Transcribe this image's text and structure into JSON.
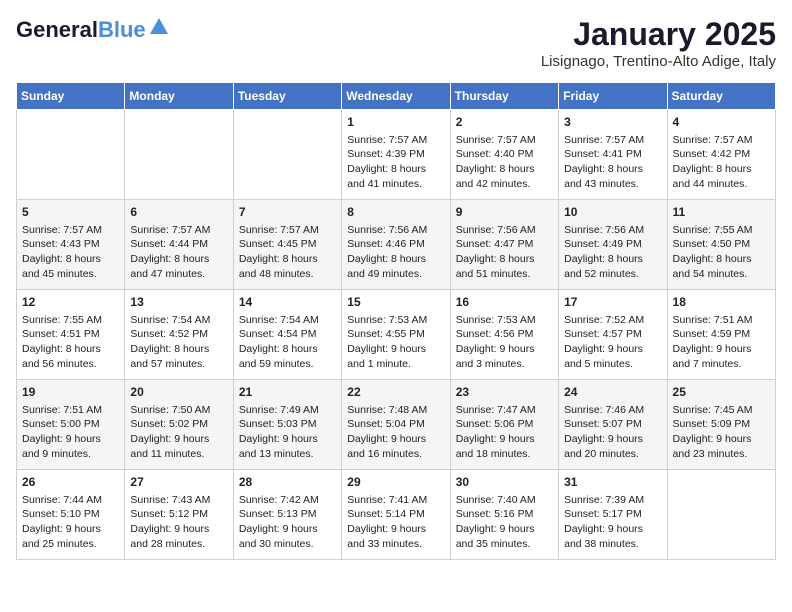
{
  "header": {
    "logo_general": "General",
    "logo_blue": "Blue",
    "month": "January 2025",
    "location": "Lisignago, Trentino-Alto Adige, Italy"
  },
  "days_of_week": [
    "Sunday",
    "Monday",
    "Tuesday",
    "Wednesday",
    "Thursday",
    "Friday",
    "Saturday"
  ],
  "weeks": [
    [
      {
        "day": "",
        "sunrise": "",
        "sunset": "",
        "daylight": ""
      },
      {
        "day": "",
        "sunrise": "",
        "sunset": "",
        "daylight": ""
      },
      {
        "day": "",
        "sunrise": "",
        "sunset": "",
        "daylight": ""
      },
      {
        "day": "1",
        "sunrise": "Sunrise: 7:57 AM",
        "sunset": "Sunset: 4:39 PM",
        "daylight": "Daylight: 8 hours and 41 minutes."
      },
      {
        "day": "2",
        "sunrise": "Sunrise: 7:57 AM",
        "sunset": "Sunset: 4:40 PM",
        "daylight": "Daylight: 8 hours and 42 minutes."
      },
      {
        "day": "3",
        "sunrise": "Sunrise: 7:57 AM",
        "sunset": "Sunset: 4:41 PM",
        "daylight": "Daylight: 8 hours and 43 minutes."
      },
      {
        "day": "4",
        "sunrise": "Sunrise: 7:57 AM",
        "sunset": "Sunset: 4:42 PM",
        "daylight": "Daylight: 8 hours and 44 minutes."
      }
    ],
    [
      {
        "day": "5",
        "sunrise": "Sunrise: 7:57 AM",
        "sunset": "Sunset: 4:43 PM",
        "daylight": "Daylight: 8 hours and 45 minutes."
      },
      {
        "day": "6",
        "sunrise": "Sunrise: 7:57 AM",
        "sunset": "Sunset: 4:44 PM",
        "daylight": "Daylight: 8 hours and 47 minutes."
      },
      {
        "day": "7",
        "sunrise": "Sunrise: 7:57 AM",
        "sunset": "Sunset: 4:45 PM",
        "daylight": "Daylight: 8 hours and 48 minutes."
      },
      {
        "day": "8",
        "sunrise": "Sunrise: 7:56 AM",
        "sunset": "Sunset: 4:46 PM",
        "daylight": "Daylight: 8 hours and 49 minutes."
      },
      {
        "day": "9",
        "sunrise": "Sunrise: 7:56 AM",
        "sunset": "Sunset: 4:47 PM",
        "daylight": "Daylight: 8 hours and 51 minutes."
      },
      {
        "day": "10",
        "sunrise": "Sunrise: 7:56 AM",
        "sunset": "Sunset: 4:49 PM",
        "daylight": "Daylight: 8 hours and 52 minutes."
      },
      {
        "day": "11",
        "sunrise": "Sunrise: 7:55 AM",
        "sunset": "Sunset: 4:50 PM",
        "daylight": "Daylight: 8 hours and 54 minutes."
      }
    ],
    [
      {
        "day": "12",
        "sunrise": "Sunrise: 7:55 AM",
        "sunset": "Sunset: 4:51 PM",
        "daylight": "Daylight: 8 hours and 56 minutes."
      },
      {
        "day": "13",
        "sunrise": "Sunrise: 7:54 AM",
        "sunset": "Sunset: 4:52 PM",
        "daylight": "Daylight: 8 hours and 57 minutes."
      },
      {
        "day": "14",
        "sunrise": "Sunrise: 7:54 AM",
        "sunset": "Sunset: 4:54 PM",
        "daylight": "Daylight: 8 hours and 59 minutes."
      },
      {
        "day": "15",
        "sunrise": "Sunrise: 7:53 AM",
        "sunset": "Sunset: 4:55 PM",
        "daylight": "Daylight: 9 hours and 1 minute."
      },
      {
        "day": "16",
        "sunrise": "Sunrise: 7:53 AM",
        "sunset": "Sunset: 4:56 PM",
        "daylight": "Daylight: 9 hours and 3 minutes."
      },
      {
        "day": "17",
        "sunrise": "Sunrise: 7:52 AM",
        "sunset": "Sunset: 4:57 PM",
        "daylight": "Daylight: 9 hours and 5 minutes."
      },
      {
        "day": "18",
        "sunrise": "Sunrise: 7:51 AM",
        "sunset": "Sunset: 4:59 PM",
        "daylight": "Daylight: 9 hours and 7 minutes."
      }
    ],
    [
      {
        "day": "19",
        "sunrise": "Sunrise: 7:51 AM",
        "sunset": "Sunset: 5:00 PM",
        "daylight": "Daylight: 9 hours and 9 minutes."
      },
      {
        "day": "20",
        "sunrise": "Sunrise: 7:50 AM",
        "sunset": "Sunset: 5:02 PM",
        "daylight": "Daylight: 9 hours and 11 minutes."
      },
      {
        "day": "21",
        "sunrise": "Sunrise: 7:49 AM",
        "sunset": "Sunset: 5:03 PM",
        "daylight": "Daylight: 9 hours and 13 minutes."
      },
      {
        "day": "22",
        "sunrise": "Sunrise: 7:48 AM",
        "sunset": "Sunset: 5:04 PM",
        "daylight": "Daylight: 9 hours and 16 minutes."
      },
      {
        "day": "23",
        "sunrise": "Sunrise: 7:47 AM",
        "sunset": "Sunset: 5:06 PM",
        "daylight": "Daylight: 9 hours and 18 minutes."
      },
      {
        "day": "24",
        "sunrise": "Sunrise: 7:46 AM",
        "sunset": "Sunset: 5:07 PM",
        "daylight": "Daylight: 9 hours and 20 minutes."
      },
      {
        "day": "25",
        "sunrise": "Sunrise: 7:45 AM",
        "sunset": "Sunset: 5:09 PM",
        "daylight": "Daylight: 9 hours and 23 minutes."
      }
    ],
    [
      {
        "day": "26",
        "sunrise": "Sunrise: 7:44 AM",
        "sunset": "Sunset: 5:10 PM",
        "daylight": "Daylight: 9 hours and 25 minutes."
      },
      {
        "day": "27",
        "sunrise": "Sunrise: 7:43 AM",
        "sunset": "Sunset: 5:12 PM",
        "daylight": "Daylight: 9 hours and 28 minutes."
      },
      {
        "day": "28",
        "sunrise": "Sunrise: 7:42 AM",
        "sunset": "Sunset: 5:13 PM",
        "daylight": "Daylight: 9 hours and 30 minutes."
      },
      {
        "day": "29",
        "sunrise": "Sunrise: 7:41 AM",
        "sunset": "Sunset: 5:14 PM",
        "daylight": "Daylight: 9 hours and 33 minutes."
      },
      {
        "day": "30",
        "sunrise": "Sunrise: 7:40 AM",
        "sunset": "Sunset: 5:16 PM",
        "daylight": "Daylight: 9 hours and 35 minutes."
      },
      {
        "day": "31",
        "sunrise": "Sunrise: 7:39 AM",
        "sunset": "Sunset: 5:17 PM",
        "daylight": "Daylight: 9 hours and 38 minutes."
      },
      {
        "day": "",
        "sunrise": "",
        "sunset": "",
        "daylight": ""
      }
    ]
  ]
}
